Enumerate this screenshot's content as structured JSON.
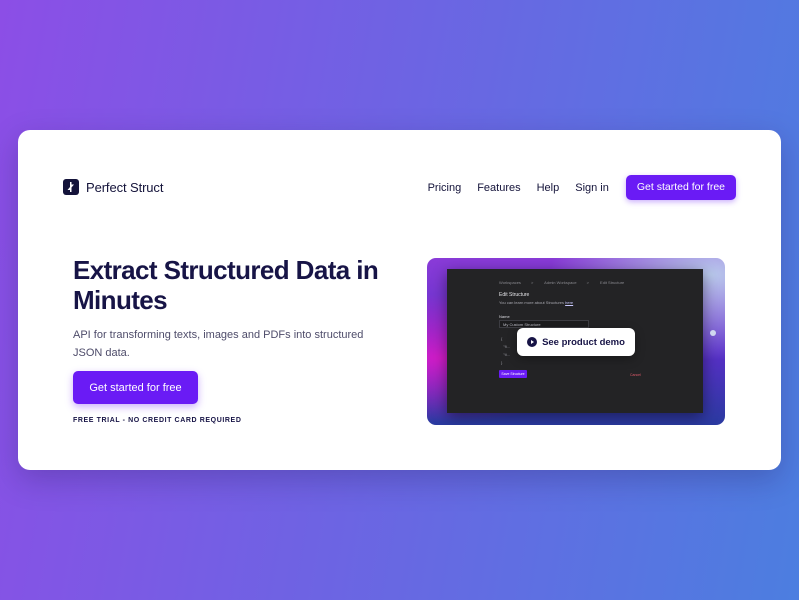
{
  "brand": {
    "name": "Perfect Struct"
  },
  "nav": {
    "links": [
      "Pricing",
      "Features",
      "Help",
      "Sign in"
    ],
    "cta": "Get started for free"
  },
  "hero": {
    "title": "Extract Structured Data in Minutes",
    "subtitle": "API for transforming texts, images and PDFs into structured JSON data.",
    "cta": "Get started for free",
    "note": "FREE TRIAL - NO CREDIT CARD REQUIRED"
  },
  "demo": {
    "play_label": "See product demo",
    "app": {
      "breadcrumb": [
        "Workspaces",
        "Admin Workspace",
        "Edit Structure"
      ],
      "heading": "Edit Structure",
      "help_text": "You can learn more about Structures",
      "help_link": "here",
      "name_label": "Name",
      "name_value": "My Custom Structure",
      "code_lines": [
        "{",
        "  \"fi...",
        "  \"ti...",
        "}"
      ],
      "save_label": "Save Structure",
      "cancel_label": "Cancel"
    }
  },
  "colors": {
    "accent": "#6a1bf5",
    "ink": "#171446"
  }
}
